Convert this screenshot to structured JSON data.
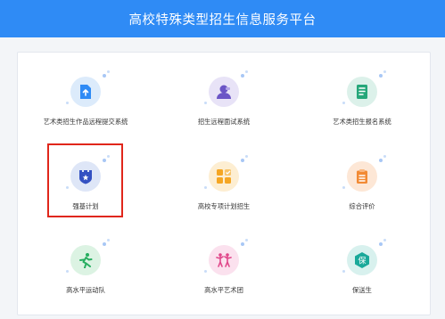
{
  "header": {
    "title": "高校特殊类型招生信息服务平台"
  },
  "tiles": [
    {
      "label": "艺术类招生作品远程提交系统",
      "icon": "upload-document-icon",
      "bg": "#dcebfb",
      "fg": "#2f8bf5"
    },
    {
      "label": "招生远程面试系统",
      "icon": "interview-person-icon",
      "bg": "#e8e3f7",
      "fg": "#6b55c6"
    },
    {
      "label": "艺术类招生报名系统",
      "icon": "registration-form-icon",
      "bg": "#dcf1ea",
      "fg": "#26a77a"
    },
    {
      "label": "强基计划",
      "icon": "shield-star-icon",
      "bg": "#dee6f7",
      "fg": "#3451c2"
    },
    {
      "label": "高校专项计划招生",
      "icon": "grid-apps-icon",
      "bg": "#fdeed2",
      "fg": "#f5a623"
    },
    {
      "label": "综合评价",
      "icon": "clipboard-icon",
      "bg": "#fde7d6",
      "fg": "#f28a34"
    },
    {
      "label": "高水平运动队",
      "icon": "running-athlete-icon",
      "bg": "#dcf3e3",
      "fg": "#27ae60"
    },
    {
      "label": "高水平艺术团",
      "icon": "dancers-icon",
      "bg": "#fbe1ee",
      "fg": "#e0478a"
    },
    {
      "label": "保送生",
      "icon": "recommend-badge-icon",
      "bg": "#d8f1ee",
      "fg": "#1aa99a",
      "glyph": "保"
    }
  ],
  "selected_tile": "强基计划",
  "colors": {
    "header": "#2f8bf5",
    "highlight_border": "#e0261b",
    "dots": "#a8c7f5"
  }
}
